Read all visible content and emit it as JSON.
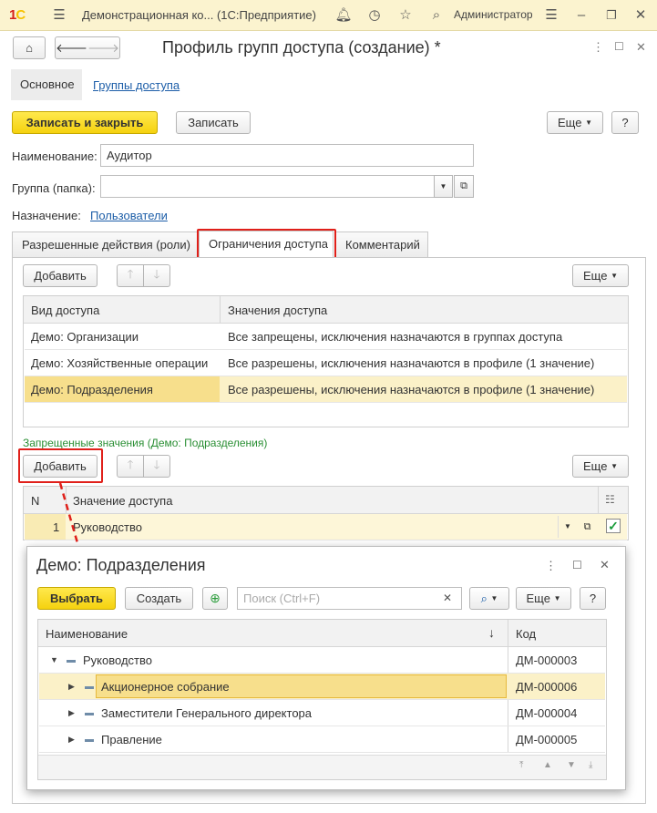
{
  "titlebar": {
    "app_title": "Демонстрационная ко... (1С:Предприятие)",
    "user": "Администратор"
  },
  "header": {
    "title": "Профиль групп доступа (создание) *"
  },
  "nav": {
    "main": "Основное",
    "groups_link": "Группы доступа"
  },
  "toolbar": {
    "save_close": "Записать и закрыть",
    "save": "Записать",
    "more": "Еще",
    "help": "?"
  },
  "form": {
    "name_label": "Наименование:",
    "name_value": "Аудитор",
    "group_label": "Группа (папка):",
    "group_value": "",
    "purpose_label": "Назначение:",
    "purpose_link": "Пользователи"
  },
  "tabs": [
    {
      "label": "Разрешенные действия (роли)"
    },
    {
      "label": "Ограничения доступа"
    },
    {
      "label": "Комментарий"
    }
  ],
  "access_table": {
    "add": "Добавить",
    "more": "Еще",
    "columns": [
      "Вид доступа",
      "Значения доступа"
    ],
    "rows": [
      {
        "kind": "Демо: Организации",
        "value": "Все запрещены, исключения назначаются в группах доступа"
      },
      {
        "kind": "Демо: Хозяйственные операции",
        "value": "Все разрешены, исключения назначаются в профиле (1 значение)"
      },
      {
        "kind": "Демо: Подразделения",
        "value": "Все разрешены, исключения назначаются в профиле (1 значение)"
      }
    ]
  },
  "forbidden": {
    "caption": "Запрещенные значения (Демо: Подразделения)",
    "add": "Добавить",
    "more": "Еще",
    "columns": [
      "N",
      "Значение доступа"
    ],
    "rows": [
      {
        "n": "1",
        "value": "Руководство"
      }
    ]
  },
  "popup": {
    "title": "Демо: Подразделения",
    "select": "Выбрать",
    "create": "Создать",
    "search_placeholder": "Поиск (Ctrl+F)",
    "more": "Еще",
    "help": "?",
    "columns": [
      "Наименование",
      "Код"
    ],
    "rows": [
      {
        "name": "Руководство",
        "code": "ДМ-000003"
      },
      {
        "name": "Акционерное собрание",
        "code": "ДМ-000006"
      },
      {
        "name": "Заместители Генерального директора",
        "code": "ДМ-000004"
      },
      {
        "name": "Правление",
        "code": "ДМ-000005"
      }
    ]
  },
  "colors": {
    "accent_yellow": "#f5d20f",
    "highlight_red": "#e0201a",
    "selection": "#fbf1c8",
    "caption_green": "#2a8f34",
    "link_blue": "#1d5ea8"
  }
}
